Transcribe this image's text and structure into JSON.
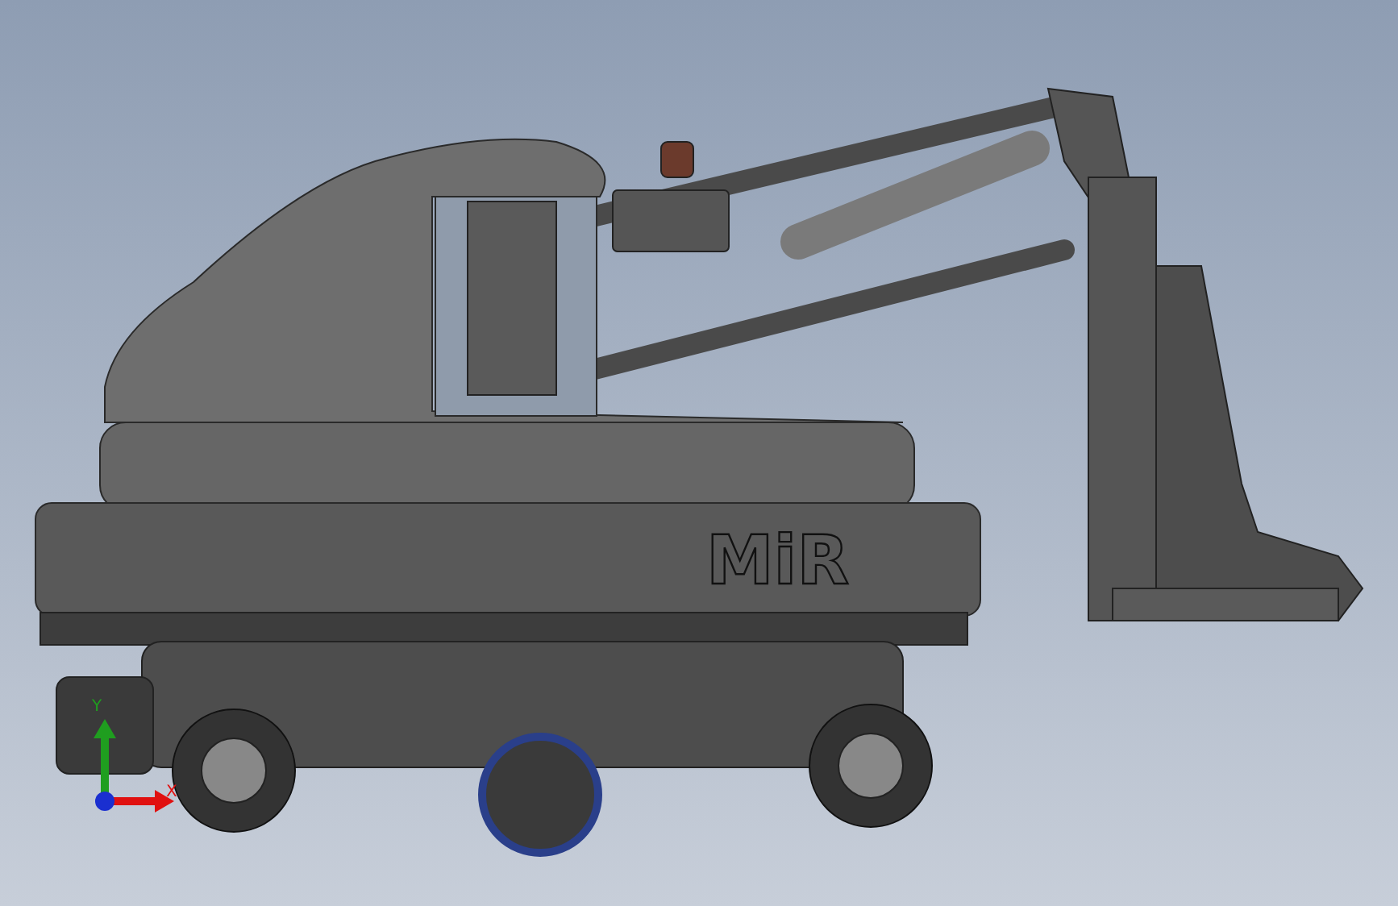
{
  "viewport": {
    "model": {
      "logo": "MiR"
    },
    "triad": {
      "axes": [
        {
          "kind": "vertical",
          "label": "Y",
          "color": "#1f9e1f"
        },
        {
          "kind": "horizontal",
          "label": "X",
          "color": "#e01010"
        }
      ]
    }
  }
}
